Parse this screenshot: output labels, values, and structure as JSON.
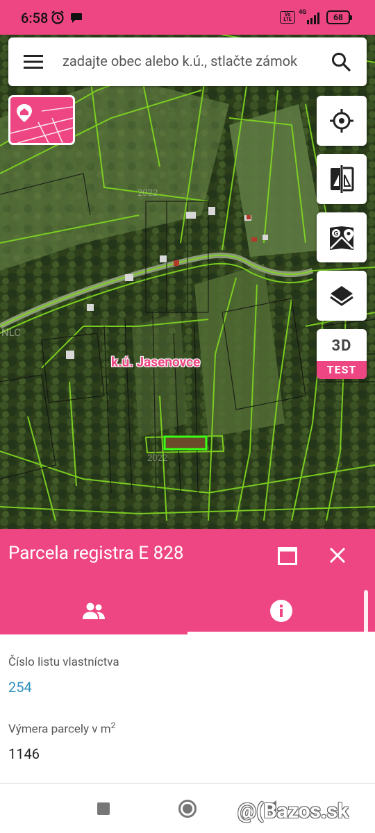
{
  "status_bar": {
    "time": "6:58",
    "volte": "Vo LTE",
    "network": "4G",
    "battery": "68"
  },
  "search": {
    "placeholder": "zadajte obec alebo k.ú., stlačte zámok"
  },
  "map": {
    "cadastral_area_label": "k.ú. Jasenovce",
    "nlc_label": "NLC",
    "year_label_1": "2022",
    "year_label_2": "2022"
  },
  "controls": {
    "btn_3d_label": "3D",
    "btn_3d_badge": "TEST"
  },
  "panel": {
    "title": "Parcela registra E 828",
    "fields": [
      {
        "label": "Číslo listu vlastníctva",
        "value": "254"
      },
      {
        "label": "Výmera parcely v m",
        "label_sup": "2",
        "value": "1146"
      }
    ]
  },
  "watermark": "@(Bazos.sk",
  "colors": {
    "accent": "#ee4682",
    "link": "#2a8fbd",
    "parcel_boundary": "#7ed321",
    "selected_parcel": "#39ff14"
  }
}
